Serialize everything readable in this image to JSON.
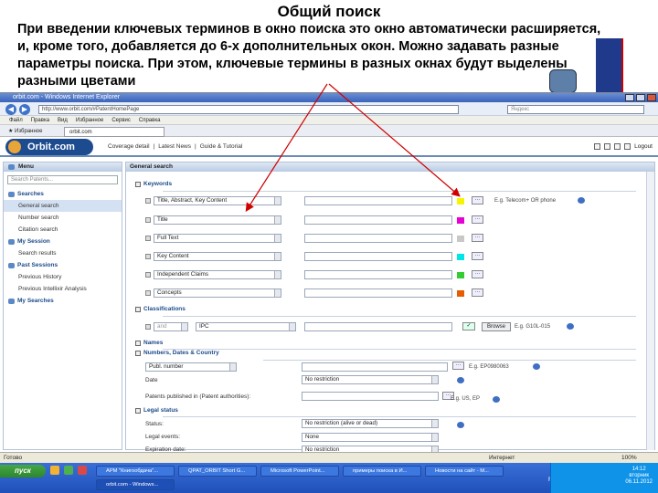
{
  "slide": {
    "title": "Общий поиск",
    "description": "При введении ключевых терминов в окно поиска это окно автоматически расширяется, и, кроме того, добавляется до 6-х дополнительных окон. Можно задавать разные параметры поиска. При этом, ключевые термины в разных окнах будут выделены разными цветами"
  },
  "browser": {
    "window_title": "orbit.com - Windows Internet Explorer",
    "url": "http://www.orbit.com/#PatentHomePage",
    "search_placeholder": "Яндекс",
    "menu": [
      "Файл",
      "Правка",
      "Вид",
      "Избранное",
      "Сервис",
      "Справка"
    ],
    "favorites_label": "Избранное",
    "tab_label": "orbit.com"
  },
  "orbit": {
    "logo": "Orbit.com",
    "top_links": [
      "Coverage detail",
      "|",
      "Latest News",
      "|",
      "Guide & Tutorial"
    ],
    "logout": "Logout"
  },
  "sidebar": {
    "menu_label": "Menu",
    "search_placeholder": "Search Patents...",
    "sections": [
      {
        "title": "Searches",
        "items": [
          "General search",
          "Number search",
          "Citation search"
        ]
      },
      {
        "title": "My Session",
        "items": [
          "Search results"
        ]
      },
      {
        "title": "Past Sessions",
        "items": [
          "Previous History",
          "Previous Intellixir Analysis"
        ]
      },
      {
        "title": "My Searches",
        "items": []
      }
    ]
  },
  "content": {
    "header": "General search",
    "keywords": {
      "title": "Keywords",
      "rows": [
        {
          "field": "Title, Abstract, Key Content",
          "color": "#f5f500",
          "example": "E.g. Telecom+ OR phone"
        },
        {
          "field": "Title",
          "color": "#e600d6"
        },
        {
          "field": "Full Text",
          "color": "#c8c8c8"
        },
        {
          "field": "Key Content",
          "color": "#00e6e6"
        },
        {
          "field": "Independent Claims",
          "color": "#33cc33"
        },
        {
          "field": "Concepts",
          "color": "#e65c00"
        }
      ]
    },
    "classifications": {
      "title": "Classifications",
      "operator": "and",
      "field": "IPC",
      "browse": "Browse",
      "example": "E.g. G10L-015"
    },
    "names": {
      "title": "Names"
    },
    "numbers": {
      "title": "Numbers, Dates & Country",
      "number_type": "Publ. number",
      "number_example": "E.g. EP0980063",
      "date_label": "Date",
      "date_value": "No restriction",
      "country_label": "Patents published in (Patent authorities):",
      "country_example": "E.g. US, EP"
    },
    "legal": {
      "title": "Legal status",
      "status_label": "Status:",
      "status_value": "No restriction (alive or dead)",
      "events_label": "Legal events:",
      "events_value": "None",
      "expiration_label": "Expiration date:",
      "expiration_value": "No restriction"
    }
  },
  "statusbar": {
    "left": "Готово",
    "zone": "Интернет",
    "zoom": "100%"
  },
  "taskbar": {
    "start": "пуск",
    "tasks_row1": [
      "АРМ \"Книгообдача\"...",
      "QPAT_ORBIT Short G...",
      "Microsoft PowerPoint...",
      "примеры поиска в И...",
      "Новости на сайт - М..."
    ],
    "tasks_row2": [
      "orbit.com - Windows..."
    ],
    "lang": "RU",
    "time": "14:12",
    "day": "вторник",
    "date": "06.11.2012"
  }
}
